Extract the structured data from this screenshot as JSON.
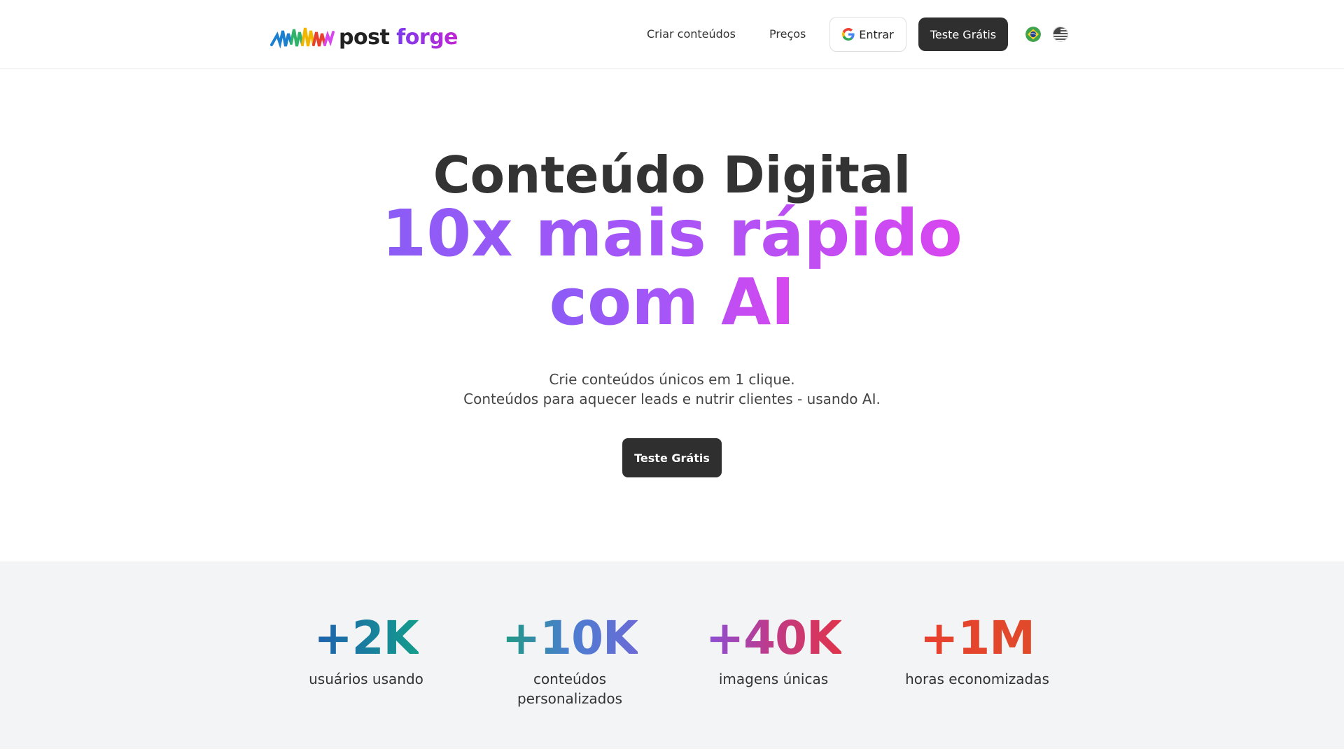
{
  "header": {
    "logo": {
      "word1": "post",
      "word2": "forge"
    },
    "nav": {
      "criar_label": "Criar conteúdos",
      "precos_label": "Preços"
    },
    "login_label": "Entrar",
    "cta_label": "Teste Grátis",
    "languages": [
      "pt-BR-flag",
      "en-US-flag"
    ]
  },
  "hero": {
    "line1": "Conteúdo Digital",
    "line2": "10x mais rápido",
    "line3": "com AI",
    "sub1": "Crie conteúdos únicos em 1 clique.",
    "sub2": "Conteúdos para aquecer leads e nutrir clientes - usando AI.",
    "cta_label": "Teste Grátis"
  },
  "stats": [
    {
      "value": "+2K",
      "label": "usuários usando"
    },
    {
      "value": "+10K",
      "label": "conteúdos personalizados"
    },
    {
      "value": "+40K",
      "label": "imagens únicas"
    },
    {
      "value": "+1M",
      "label": "horas economizadas"
    }
  ],
  "colors": {
    "dark_button": "#2f2f2f",
    "hero_gradient_start": "#8b5cf6",
    "hero_gradient_end": "#d946ef",
    "stats_background": "#f3f4f6"
  }
}
